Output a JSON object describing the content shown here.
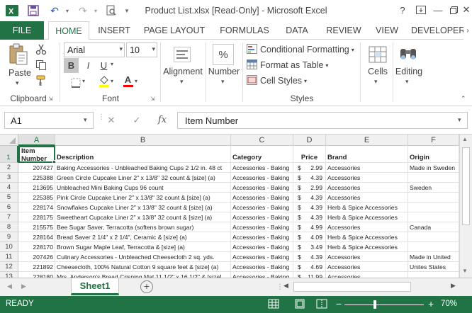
{
  "window": {
    "title": "Product List.xlsx  [Read-Only] - Microsoft Excel",
    "help": "?"
  },
  "tabs": {
    "file": "FILE",
    "items": [
      "HOME",
      "INSERT",
      "PAGE LAYOUT",
      "FORMULAS",
      "DATA",
      "REVIEW",
      "VIEW",
      "DEVELOPER"
    ],
    "active": "HOME"
  },
  "ribbon": {
    "clipboard": {
      "paste": "Paste",
      "label": "Clipboard"
    },
    "font": {
      "name": "Arial",
      "size": "10",
      "bold": "B",
      "italic": "I",
      "underline": "U",
      "fontcolor": "A",
      "label": "Font"
    },
    "alignment": {
      "label": "Alignment"
    },
    "number": {
      "label": "Number",
      "symbol": "%"
    },
    "styles": {
      "cond": "Conditional Formatting",
      "table": "Format as Table",
      "cell": "Cell Styles",
      "label": "Styles"
    },
    "cells": {
      "label": "Cells"
    },
    "editing": {
      "label": "Editing"
    }
  },
  "formulabar": {
    "namebox": "A1",
    "content": "Item Number",
    "fx": "fx"
  },
  "columns": [
    "A",
    "B",
    "C",
    "D",
    "E",
    "F"
  ],
  "header_row": {
    "row": "1",
    "a1": "Item",
    "a2": "Number",
    "b": "Description",
    "c": "Category",
    "d": "Price",
    "e": "Brand",
    "f": "Origin"
  },
  "rows": [
    {
      "r": "2",
      "a": "207427",
      "b": "Baking Accessories - Unbleached Baking Cups 2 1/2 in. 48 ct",
      "c": "Accessories - Baking",
      "d": "2.99",
      "e": "Accessories",
      "f": "Made in Sweden"
    },
    {
      "r": "3",
      "a": "225388",
      "b": "Green Circle Cupcake Liner 2\" x 13/8\" 32 count & [size] (a)",
      "c": "Accessories - Baking",
      "d": "4.39",
      "e": "Accessories",
      "f": ""
    },
    {
      "r": "4",
      "a": "213695",
      "b": "Unbleached Mini Baking Cups 96 count",
      "c": "Accessories - Baking",
      "d": "2.99",
      "e": "Accessories",
      "f": "Sweden"
    },
    {
      "r": "5",
      "a": "225385",
      "b": "Pink Circle Cupcake Liner 2\" x 13/8\" 32 count & [size] (a)",
      "c": "Accessories - Baking",
      "d": "4.39",
      "e": "Accessories",
      "f": ""
    },
    {
      "r": "6",
      "a": "228174",
      "b": "Snowflakes Cupcake Liner 2\" x 13/8\" 32 count & [size] (a)",
      "c": "Accessories - Baking",
      "d": "4.39",
      "e": "Herb & Spice Accessories",
      "f": ""
    },
    {
      "r": "7",
      "a": "228175",
      "b": "Sweetheart Cupcake Liner 2\" x 13/8\" 32 count & [size] (a)",
      "c": "Accessories - Baking",
      "d": "4.39",
      "e": "Herb & Spice Accessories",
      "f": ""
    },
    {
      "r": "8",
      "a": "215575",
      "b": "Bee Sugar Saver, Terracotta (softens brown sugar)",
      "c": "Accessories - Baking",
      "d": "4.99",
      "e": "Accessories",
      "f": "Canada"
    },
    {
      "r": "9",
      "a": "228164",
      "b": "Bread Saver 2 1/4\" x 2 1/4\", Ceramic & [size] (a)",
      "c": "Accessories - Baking",
      "d": "4.09",
      "e": "Herb & Spice Accessories",
      "f": ""
    },
    {
      "r": "10",
      "a": "228170",
      "b": "Brown Sugar Maple Leaf, Terracotta & [size] (a)",
      "c": "Accessories - Baking",
      "d": "3.49",
      "e": "Herb & Spice Accessories",
      "f": ""
    },
    {
      "r": "11",
      "a": "207426",
      "b": "Culinary Accessories - Unbleached Cheesecloth 2 sq. yds.",
      "c": "Accessories - Baking",
      "d": "4.39",
      "e": "Accessories",
      "f": "Made in United"
    },
    {
      "r": "12",
      "a": "221892",
      "b": "Cheesecloth, 100% Natural Cotton 9 square feet & [size] (a)",
      "c": "Accessories - Baking",
      "d": "4.69",
      "e": "Accessories",
      "f": "Unites States"
    },
    {
      "r": "13",
      "a": "228180",
      "b": "Mrs. Anderson's Bread Crisping Mat 11 1/2\" x 16 1/2\" & [size]",
      "c": "Accessories - Baking",
      "d": "11.99",
      "e": "Accessories",
      "f": ""
    }
  ],
  "currency": "$",
  "sheet": {
    "tab": "Sheet1",
    "add": "+"
  },
  "status": {
    "ready": "READY",
    "zoom": "70%",
    "minus": "−",
    "plus": "+"
  }
}
